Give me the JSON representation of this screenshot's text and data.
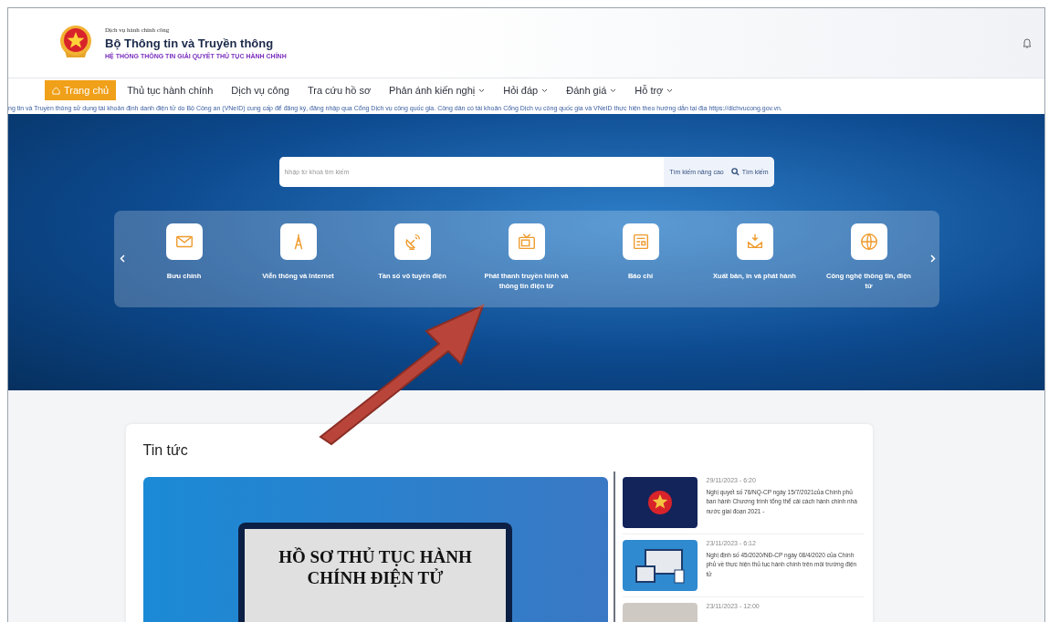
{
  "header": {
    "agency_small": "Dịch vụ hành chính công",
    "ministry": "Bộ Thông tin và Truyền thông",
    "system": "HỆ THỐNG THÔNG TIN GIẢI QUYẾT THỦ TỤC HÀNH CHÍNH"
  },
  "nav": [
    {
      "label": "Trang chủ",
      "selected": true,
      "has_menu": false
    },
    {
      "label": "Thủ tục hành chính",
      "selected": false,
      "has_menu": false
    },
    {
      "label": "Dịch vụ công",
      "selected": false,
      "has_menu": false
    },
    {
      "label": "Tra cứu hồ sơ",
      "selected": false,
      "has_menu": false
    },
    {
      "label": "Phản ánh kiến nghị",
      "selected": false,
      "has_menu": true
    },
    {
      "label": "Hỏi đáp",
      "selected": false,
      "has_menu": true
    },
    {
      "label": "Đánh giá",
      "selected": false,
      "has_menu": true
    },
    {
      "label": "Hỗ trợ",
      "selected": false,
      "has_menu": true
    }
  ],
  "marquee": "ng tin và Truyền thông sử dụng tài khoản định danh điện tử do Bộ Công an (VNeID) cung cấp để đăng ký, đăng nhập qua Cổng Dịch vụ công quốc gia. Công dân có tài khoản Cổng Dịch vụ công quốc gia và VNeID thực hiện theo hướng dẫn tại địa https://dichvucong.gov.vn.",
  "search": {
    "placeholder": "Nhập từ khoá tìm kiếm",
    "advanced": "Tìm kiếm nâng cao",
    "button": "Tìm kiếm"
  },
  "categories": [
    {
      "kind": "mail",
      "label": "Bưu chính"
    },
    {
      "kind": "tower",
      "label": "Viễn thông và Internet"
    },
    {
      "kind": "dish",
      "label": "Tần số vô tuyến điện"
    },
    {
      "kind": "tv",
      "label": "Phát thanh truyền hình và thông tin điện tử"
    },
    {
      "kind": "news",
      "label": "Báo chí"
    },
    {
      "kind": "print",
      "label": "Xuất bản, in và phát hành"
    },
    {
      "kind": "globe",
      "label": "Công nghệ thông tin, điện tử"
    }
  ],
  "news": {
    "title": "Tin tức",
    "featured_caption": "HỒ SƠ THỦ TỤC HÀNH CHÍNH ĐIỆN TỬ",
    "items": [
      {
        "kind": "emblem",
        "date": "29/11/2023 - 6:20",
        "text": "Nghị quyết số 76/NQ-CP ngày 15/7/2021của Chính phủ ban hành Chương trình tổng thể cải cách hành chính nhà nước giai đoạn 2021 -"
      },
      {
        "kind": "screens",
        "date": "23/11/2023 - 6:12",
        "text": "Nghị định số 45/2020/NĐ-CP ngày 08/4/2020 của Chính phủ về thực hiện thủ tục hành chính trên môi trường điện tử"
      },
      {
        "kind": "photo",
        "date": "23/11/2023 - 12:00"
      }
    ]
  }
}
